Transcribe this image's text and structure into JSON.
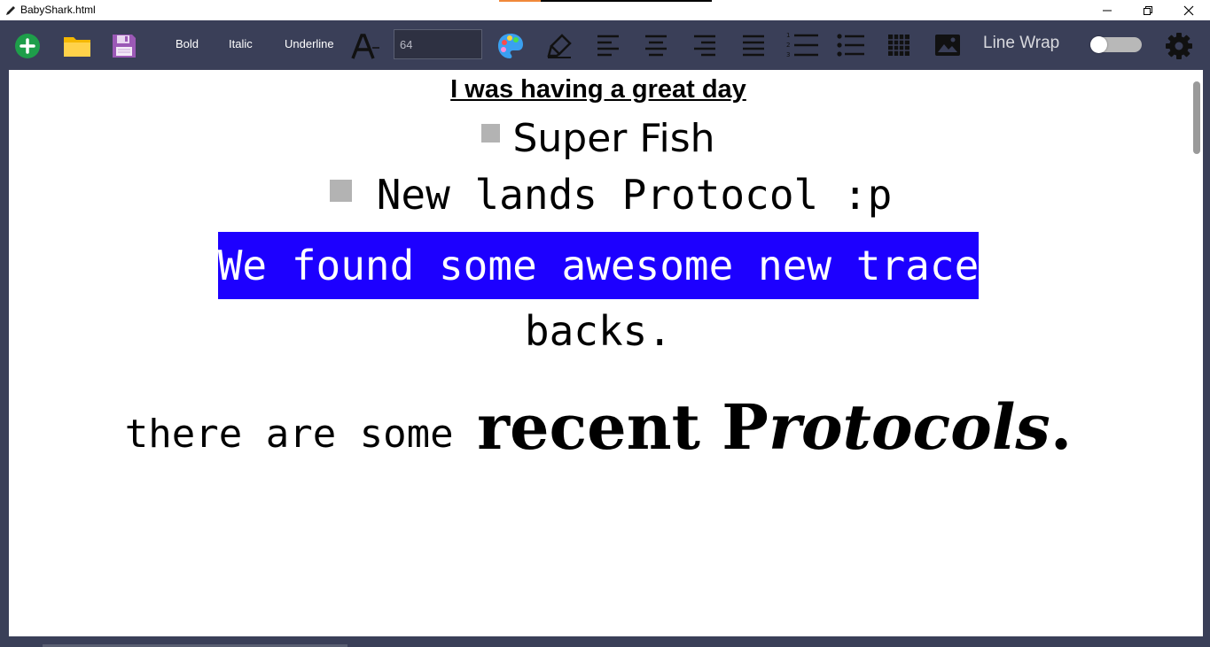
{
  "window": {
    "title": "BabyShark.html"
  },
  "toolbar": {
    "bold_label": "Bold",
    "italic_label": "Italic",
    "underline_label": "Underline",
    "font_size_value": "64",
    "line_wrap_label": "Line Wrap",
    "line_wrap_on": false,
    "icons": [
      "add-icon",
      "folder-icon",
      "save-icon",
      "font-size-decrease-icon",
      "palette-icon",
      "highlighter-icon",
      "align-left-icon",
      "align-center-icon",
      "align-right-icon",
      "align-justify-icon",
      "ordered-list-icon",
      "unordered-list-icon",
      "table-icon",
      "image-icon",
      "settings-icon"
    ]
  },
  "document": {
    "heading": "I was having a great day ",
    "bullet_1": "Super Fish",
    "bullet_2": "New lands Protocol :p",
    "highlighted_text": "We found some awesome new trace",
    "continuation": "backs.",
    "recent_prefix": "there are some ",
    "recent_bold": "recent P",
    "recent_italic": "rotocols",
    "recent_period": "."
  },
  "colors": {
    "toolbar_bg": "#3a3f58",
    "highlight_bg": "#1d00ff",
    "add_green": "#1e9e4a",
    "folder_yellow": "#f5b800",
    "save_purple": "#9b59b6"
  }
}
